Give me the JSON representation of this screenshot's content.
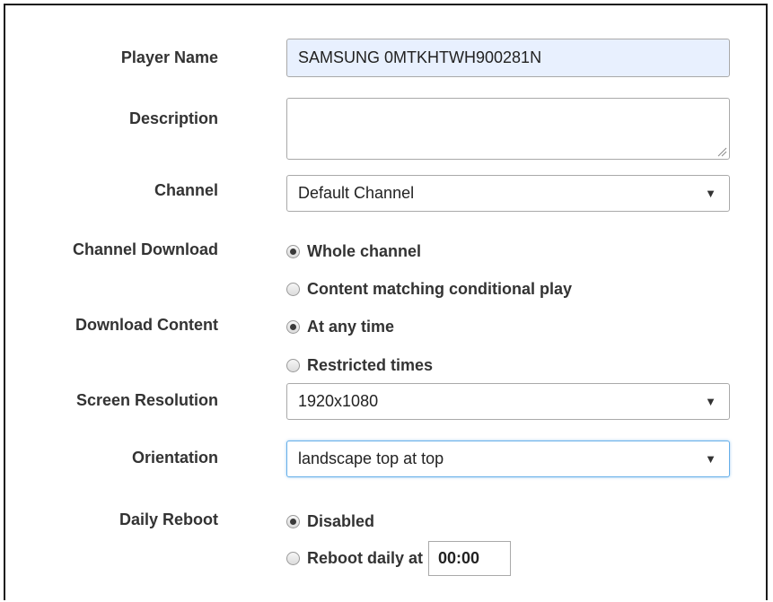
{
  "form": {
    "player_name": {
      "label": "Player Name",
      "value": "SAMSUNG 0MTKHTWH900281N"
    },
    "description": {
      "label": "Description",
      "value": ""
    },
    "channel": {
      "label": "Channel",
      "value": "Default Channel"
    },
    "channel_download": {
      "label": "Channel Download",
      "options": [
        {
          "label": "Whole channel",
          "checked": true
        },
        {
          "label": "Content matching conditional play",
          "checked": false
        }
      ]
    },
    "download_content": {
      "label": "Download Content",
      "options": [
        {
          "label": "At any time",
          "checked": true
        },
        {
          "label": "Restricted times",
          "checked": false
        }
      ]
    },
    "screen_resolution": {
      "label": "Screen Resolution",
      "value": "1920x1080"
    },
    "orientation": {
      "label": "Orientation",
      "value": "landscape top at top"
    },
    "daily_reboot": {
      "label": "Daily Reboot",
      "options": [
        {
          "label": "Disabled",
          "checked": true
        },
        {
          "label": "Reboot daily at",
          "checked": false
        }
      ],
      "time": "00:00"
    }
  },
  "icons": {
    "dropdown": "chevron-down-icon",
    "caret_glyph": "▼"
  }
}
